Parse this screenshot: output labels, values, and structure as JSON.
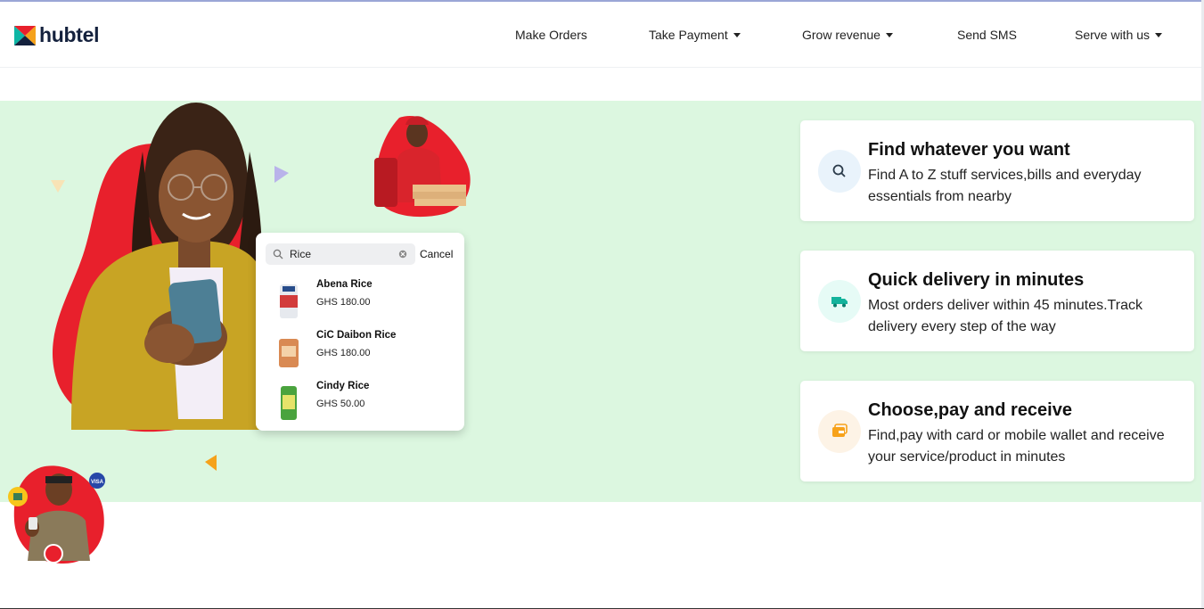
{
  "brand": {
    "name": "hubtel"
  },
  "nav": [
    {
      "label": "Make Orders",
      "has_dropdown": false
    },
    {
      "label": "Take Payment",
      "has_dropdown": true
    },
    {
      "label": "Grow revenue",
      "has_dropdown": true
    },
    {
      "label": "Send SMS",
      "has_dropdown": false
    },
    {
      "label": "Serve with us",
      "has_dropdown": true
    }
  ],
  "search_demo": {
    "query": "Rice",
    "cancel_label": "Cancel",
    "results": [
      {
        "name": "Abena Rice",
        "price": "GHS 180.00"
      },
      {
        "name": "CiC Daibon Rice",
        "price": "GHS 180.00"
      },
      {
        "name": "Cindy Rice",
        "price": "GHS 50.00"
      }
    ]
  },
  "features": [
    {
      "title": "Find whatever you want",
      "description": "Find A to Z stuff services,bills and everyday essentials from nearby",
      "icon": "search-icon"
    },
    {
      "title": "Quick delivery in minutes",
      "description": "Most orders deliver within 45 minutes.Track delivery every step of the way",
      "icon": "truck-icon"
    },
    {
      "title": "Choose,pay and receive",
      "description": "Find,pay with card or mobile wallet and receive your service/product in minutes",
      "icon": "wallet-icon"
    }
  ],
  "hero_badges": {
    "card_brand": "VISA"
  },
  "colors": {
    "hero_bg": "#dcf7e0",
    "brand_red": "#e8202c",
    "brand_teal": "#01c7b1",
    "brand_orange": "#f7a21b",
    "text_dark": "#14213d"
  }
}
